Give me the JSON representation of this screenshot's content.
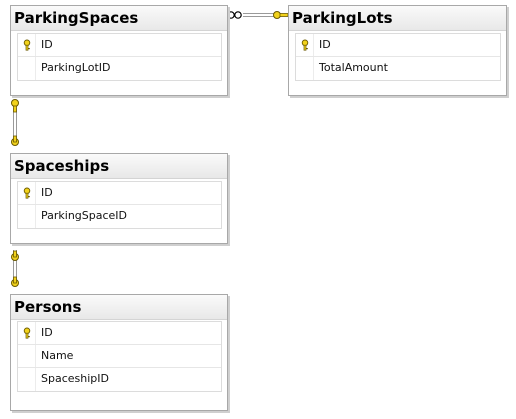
{
  "tables": {
    "parking_spaces": {
      "title": "ParkingSpaces",
      "columns": [
        {
          "name": "ID",
          "key": "primary-key-icon"
        },
        {
          "name": "ParkingLotID",
          "key": ""
        }
      ]
    },
    "parking_lots": {
      "title": "ParkingLots",
      "columns": [
        {
          "name": "ID",
          "key": "primary-key-icon"
        },
        {
          "name": "TotalAmount",
          "key": ""
        }
      ]
    },
    "spaceships": {
      "title": "Spaceships",
      "columns": [
        {
          "name": "ID",
          "key": "primary-key-icon"
        },
        {
          "name": "ParkingSpaceID",
          "key": ""
        }
      ]
    },
    "persons": {
      "title": "Persons",
      "columns": [
        {
          "name": "ID",
          "key": "primary-key-icon"
        },
        {
          "name": "Name",
          "key": ""
        },
        {
          "name": "SpaceshipID",
          "key": ""
        }
      ]
    }
  },
  "relationships": [
    {
      "from": "ParkingSpaces",
      "to": "ParkingLots",
      "from_end": "infinity-icon",
      "to_end": "key-icon"
    },
    {
      "from": "ParkingSpaces",
      "to": "Spaceships",
      "from_end": "key-icon",
      "to_end": "key-icon"
    },
    {
      "from": "Spaceships",
      "to": "Persons",
      "from_end": "key-icon",
      "to_end": "key-icon"
    }
  ],
  "colors": {
    "border": "#a8a8a8",
    "header_bg": "#eaeaea",
    "key_gold": "#f2d21b",
    "connector": "#a0a0a0"
  }
}
